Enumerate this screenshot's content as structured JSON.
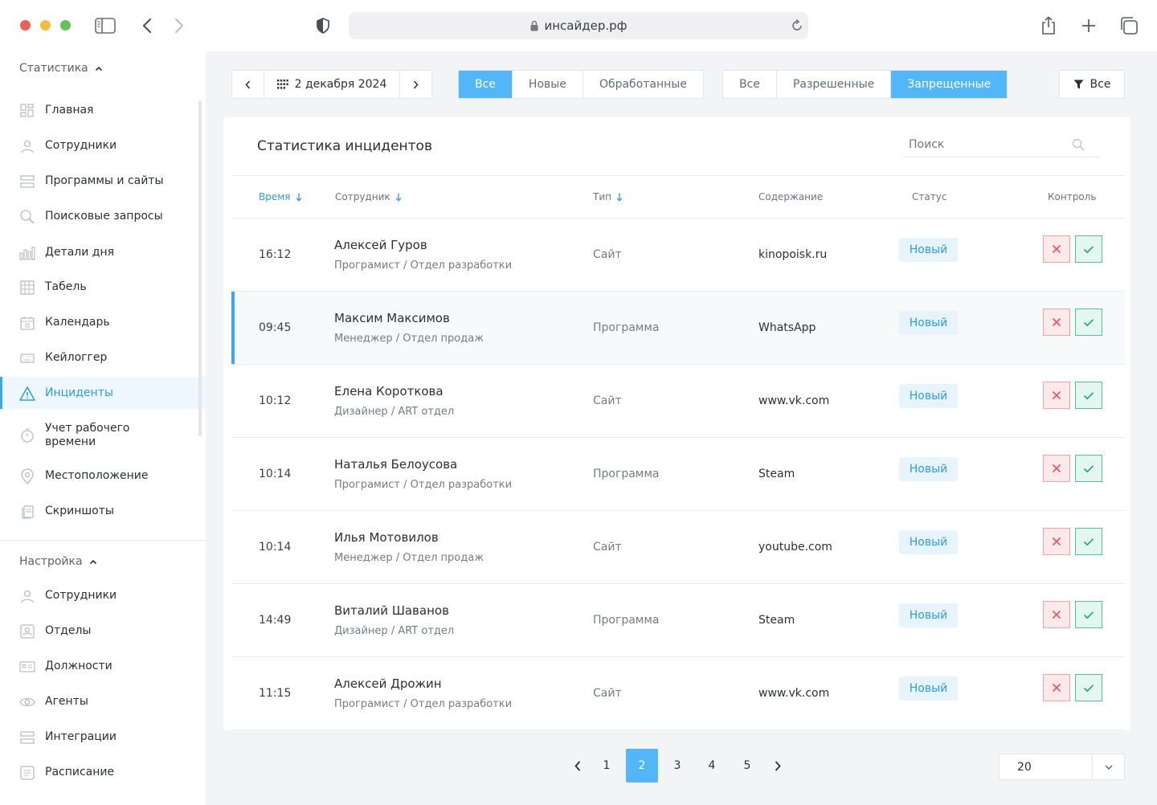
{
  "browser": {
    "url": "инсайдер.рф",
    "colors": {
      "close": "#ee5f57",
      "minimize": "#f6bd3b",
      "maximize": "#60c554"
    }
  },
  "sidebar": {
    "stats_section": "Статистика",
    "stats_items": [
      {
        "label": "Главная",
        "icon": "dashboard-icon"
      },
      {
        "label": "Сотрудники",
        "icon": "user-icon"
      },
      {
        "label": "Программы и сайты",
        "icon": "list-icon"
      },
      {
        "label": "Поисковые запросы",
        "icon": "search-icon"
      },
      {
        "label": "Детали дня",
        "icon": "bar-chart-icon"
      },
      {
        "label": "Табель",
        "icon": "grid-icon"
      },
      {
        "label": "Календарь",
        "icon": "calendar-icon"
      },
      {
        "label": "Кейлоггер",
        "icon": "keyboard-icon"
      },
      {
        "label": "Инциденты",
        "icon": "warning-icon",
        "active": true
      },
      {
        "label": "Учет рабочего времени",
        "icon": "stopwatch-icon"
      },
      {
        "label": "Местоположение",
        "icon": "location-icon"
      },
      {
        "label": "Скриншоты",
        "icon": "screenshots-icon"
      }
    ],
    "settings_section": "Настройка",
    "settings_items": [
      {
        "label": "Сотрудники",
        "icon": "user-icon"
      },
      {
        "label": "Отделы",
        "icon": "department-icon"
      },
      {
        "label": "Должности",
        "icon": "id-card-icon"
      },
      {
        "label": "Агенты",
        "icon": "eye-icon"
      },
      {
        "label": "Интеграции",
        "icon": "list-icon"
      },
      {
        "label": "Расписание",
        "icon": "schedule-icon"
      }
    ]
  },
  "toolbar": {
    "date": "2 декабря 2024",
    "status_filter": [
      "Все",
      "Новые",
      "Обработанные"
    ],
    "status_selected": "Все",
    "permission_filter": [
      "Все",
      "Разрешенные",
      "Запрещенные"
    ],
    "permission_selected": "Запрещенные",
    "filter_label": "Все"
  },
  "card": {
    "title": "Статистика инцидентов",
    "search_placeholder": "Поиск",
    "columns": {
      "time": "Время",
      "employee": "Сотрудник",
      "type": "Тип",
      "content": "Содержание",
      "status": "Статус",
      "control": "Контроль"
    },
    "rows": [
      {
        "time": "16:12",
        "name": "Алексей Гуров",
        "role": "Програмист / Отдел разработки",
        "type": "Сайт",
        "content": "kinopoisk.ru",
        "status": "Новый"
      },
      {
        "time": "09:45",
        "name": "Максим Максимов",
        "role": "Менеджер / Отдел продаж",
        "type": "Программа",
        "content": "WhatsApp",
        "status": "Новый",
        "highlighted": true
      },
      {
        "time": "10:12",
        "name": "Елена Короткова",
        "role": "Дизайнер / ART отдел",
        "type": "Сайт",
        "content": "www.vk.com",
        "status": "Новый"
      },
      {
        "time": "10:14",
        "name": "Наталья Белоусова",
        "role": "Програмист / Отдел разработки",
        "type": "Программа",
        "content": "Steam",
        "status": "Новый"
      },
      {
        "time": "10:14",
        "name": "Илья Мотовилов",
        "role": "Менеджер / Отдел продаж",
        "type": "Сайт",
        "content": "youtube.com",
        "status": "Новый"
      },
      {
        "time": "14:49",
        "name": "Виталий Шаванов",
        "role": "Дизайнер / ART отдел",
        "type": "Программа",
        "content": "Steam",
        "status": "Новый"
      },
      {
        "time": "11:15",
        "name": "Алексей Дрожин",
        "role": "Програмист / Отдел разработки",
        "type": "Сайт",
        "content": "www.vk.com",
        "status": "Новый"
      }
    ]
  },
  "pagination": {
    "pages": [
      "1",
      "2",
      "3",
      "4",
      "5"
    ],
    "current": "2",
    "per_page": "20"
  },
  "colors": {
    "accent": "#52b6f8",
    "reject": "#e8505b",
    "approve": "#1fa672"
  }
}
